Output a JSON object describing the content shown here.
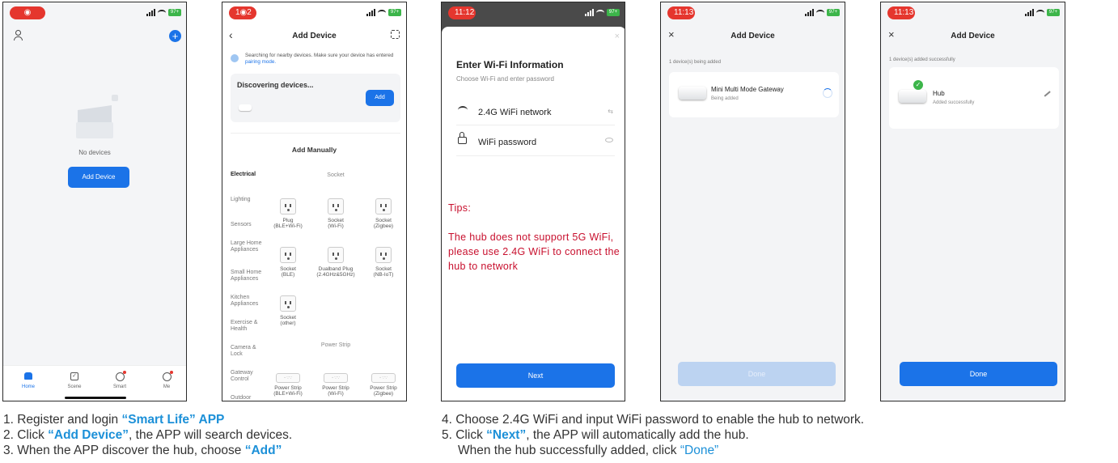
{
  "screens": {
    "home": {
      "status_time": "◉",
      "battery": "97+",
      "empty_text": "No devices",
      "add_device_button": "Add Device",
      "tabs": [
        {
          "label": "Home",
          "active": true
        },
        {
          "label": "Scene",
          "active": false
        },
        {
          "label": "Smart",
          "active": false
        },
        {
          "label": "Me",
          "active": false
        }
      ]
    },
    "add_device": {
      "status_time": "1◉2",
      "battery": "97+",
      "title": "Add Device",
      "search_text": "Searching for nearby devices. Make sure your device has entered ",
      "pairing_link": "pairing mode.",
      "discovering": "Discovering devices...",
      "add_button": "Add",
      "add_manually": "Add Manually",
      "categories": [
        "Electrical",
        "Lighting",
        "Sensors",
        "Large Home Appliances",
        "Small Home Appliances",
        "Kitchen Appliances",
        "Exercise & Health",
        "Camera & Lock",
        "Gateway Control",
        "Outdoor"
      ],
      "section_socket": "Socket",
      "section_power_strip": "Power Strip",
      "sockets": [
        {
          "name": "Plug",
          "sub": "(BLE+Wi-Fi)"
        },
        {
          "name": "Socket",
          "sub": "(Wi-Fi)"
        },
        {
          "name": "Socket",
          "sub": "(Zigbee)"
        },
        {
          "name": "Socket",
          "sub": "(BLE)"
        },
        {
          "name": "Dualband Plug",
          "sub": "(2.4GHz&5GHz)"
        },
        {
          "name": "Socket",
          "sub": "(NB-IoT)"
        },
        {
          "name": "Socket",
          "sub": "(other)"
        }
      ],
      "strips": [
        {
          "name": "Power Strip",
          "sub": "(BLE+Wi-Fi)"
        },
        {
          "name": "Power Strip",
          "sub": "(Wi-Fi)"
        },
        {
          "name": "Power Strip",
          "sub": "(Zigbee)"
        }
      ]
    },
    "wifi": {
      "status_time": "11:12",
      "battery": "97+",
      "title": "Enter Wi-Fi Information",
      "subtitle": "Choose Wi-Fi and enter password",
      "network": "2.4G WiFi network",
      "password_placeholder": "WiFi password",
      "tips_title": "Tips:",
      "tips_body": "The hub does not support 5G WiFi, please use 2.4G WiFi to connect the hub to network",
      "next_button": "Next"
    },
    "adding": {
      "status_time": "11:13",
      "battery": "97+",
      "title": "Add Device",
      "count_text": "1 device(s) being added",
      "device_name": "Mini Multi Mode Gateway",
      "device_status": "Being added",
      "done_button": "Done"
    },
    "added": {
      "status_time": "11:13",
      "battery": "97+",
      "title": "Add Device",
      "count_text": "1 device(s) added successfully",
      "device_name": "Hub",
      "device_status": "Added successfully",
      "done_button": "Done"
    }
  },
  "instructions": {
    "line1_pre": "1. Register and login ",
    "line1_hl": "“Smart Life” APP",
    "line2_pre": "2. Click ",
    "line2_hl": "“Add Device”",
    "line2_post": ", the APP will search devices.",
    "line3_pre": "3. When the APP discover the hub, choose ",
    "line3_hl": "“Add”",
    "line4": "4. Choose 2.4G WiFi and input WiFi password to enable the hub to network.",
    "line5_pre": "5. Click ",
    "line5_hl": "“Next”",
    "line5_post": ", the APP will automatically add the hub.",
    "line6_pre": "When the hub successfully added, click ",
    "line6_hl": "“Done”"
  },
  "colors": {
    "accent": "#1b73e8",
    "highlight": "#1c90d8",
    "tips": "#c8102e",
    "status_pill": "#e5362e",
    "battery": "#3cb54a"
  }
}
